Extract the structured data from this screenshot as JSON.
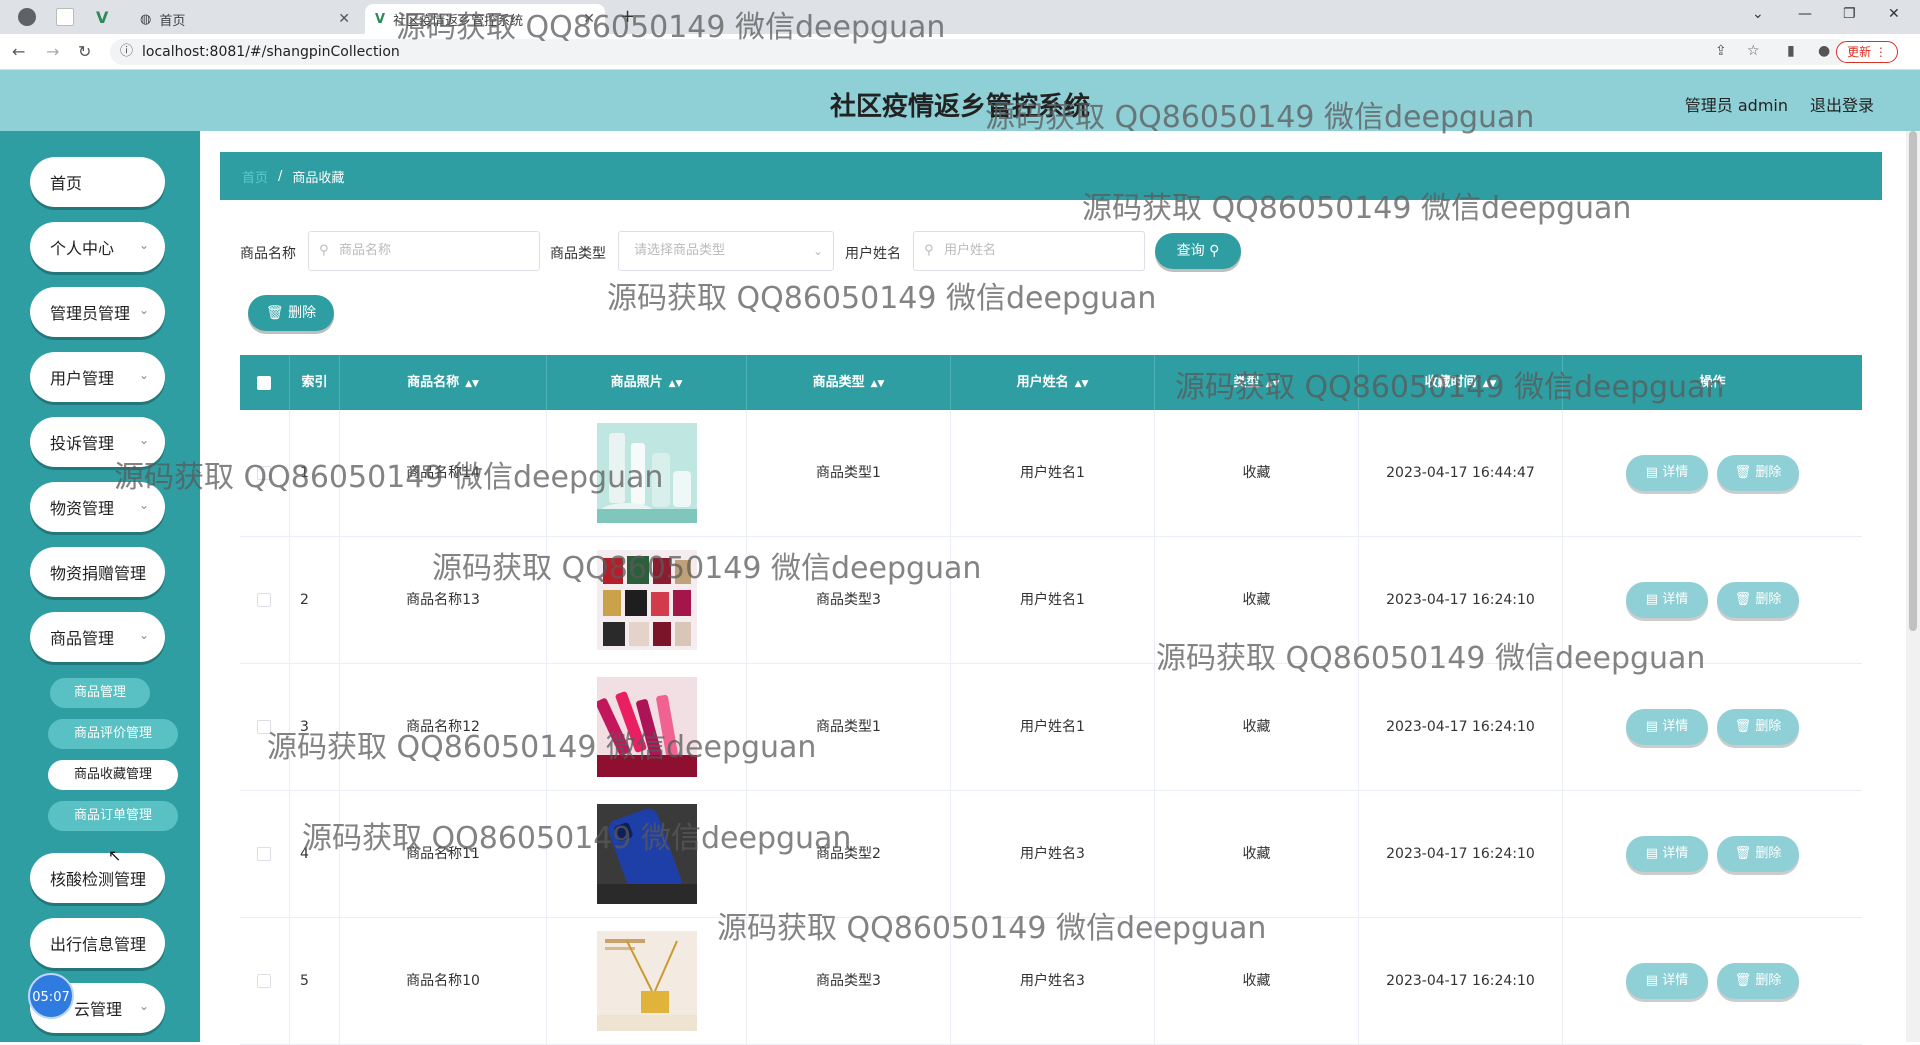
{
  "browser": {
    "tabs": [
      {
        "label": "首页"
      },
      {
        "label": "社区疫情返乡管控系统"
      }
    ],
    "new_tab": "+",
    "url": "localhost:8081/#/shangpinCollection",
    "update_label": "更新"
  },
  "header": {
    "title": "社区疫情返乡管控系统",
    "user": "管理员 admin",
    "logout": "退出登录"
  },
  "sidebar": {
    "items": [
      {
        "label": "首页",
        "expandable": false
      },
      {
        "label": "个人中心",
        "expandable": true
      },
      {
        "label": "管理员管理",
        "expandable": true
      },
      {
        "label": "用户管理",
        "expandable": true
      },
      {
        "label": "投诉管理",
        "expandable": true
      },
      {
        "label": "物资管理",
        "expandable": true
      },
      {
        "label": "物资捐赠管理",
        "expandable": false
      },
      {
        "label": "商品管理",
        "expandable": true
      },
      {
        "label": "核酸检测管理",
        "expandable": false
      },
      {
        "label": "出行信息管理",
        "expandable": false
      },
      {
        "label": "云管理",
        "expandable": true
      }
    ],
    "sub_items": [
      {
        "label": "商品管理",
        "active": false
      },
      {
        "label": "商品评价管理",
        "active": false
      },
      {
        "label": "商品收藏管理",
        "active": true
      },
      {
        "label": "商品订单管理",
        "active": false
      }
    ],
    "time_badge": "05:07"
  },
  "breadcrumb": {
    "home": "首页",
    "separator": "/",
    "current": "商品收藏"
  },
  "search": {
    "name_label": "商品名称",
    "name_placeholder": "商品名称",
    "type_label": "商品类型",
    "type_placeholder": "请选择商品类型",
    "user_label": "用户姓名",
    "user_placeholder": "用户姓名",
    "query_button": "查询"
  },
  "toolbar": {
    "delete_label": "删除"
  },
  "table": {
    "columns": [
      "索引",
      "商品名称",
      "商品照片",
      "商品类型",
      "用户姓名",
      "类型",
      "收藏时间",
      "操作"
    ],
    "rows": [
      {
        "index": "1",
        "name": "商品名称14",
        "type": "商品类型1",
        "user": "用户姓名1",
        "kind": "收藏",
        "time": "2023-04-17 16:44:47",
        "image": "cosmetics-bottles"
      },
      {
        "index": "2",
        "name": "商品名称13",
        "type": "商品类型3",
        "user": "用户姓名1",
        "kind": "收藏",
        "time": "2023-04-17 16:24:10",
        "image": "perfume-collection"
      },
      {
        "index": "3",
        "name": "商品名称12",
        "type": "商品类型1",
        "user": "用户姓名1",
        "kind": "收藏",
        "time": "2023-04-17 16:24:10",
        "image": "lipsticks"
      },
      {
        "index": "4",
        "name": "商品名称11",
        "type": "商品类型2",
        "user": "用户姓名3",
        "kind": "收藏",
        "time": "2023-04-17 16:24:10",
        "image": "blue-phone"
      },
      {
        "index": "5",
        "name": "商品名称10",
        "type": "商品类型3",
        "user": "用户姓名3",
        "kind": "收藏",
        "time": "2023-04-17 16:24:10",
        "image": "gold-pendant"
      }
    ],
    "detail_label": "详情",
    "delete_label": "删除"
  },
  "watermark": "源码获取 QQ86050149 微信deepguan",
  "colors": {
    "primary": "#2f9ea2",
    "header": "#8fd0d6",
    "action_button": "#8fd0d6"
  }
}
